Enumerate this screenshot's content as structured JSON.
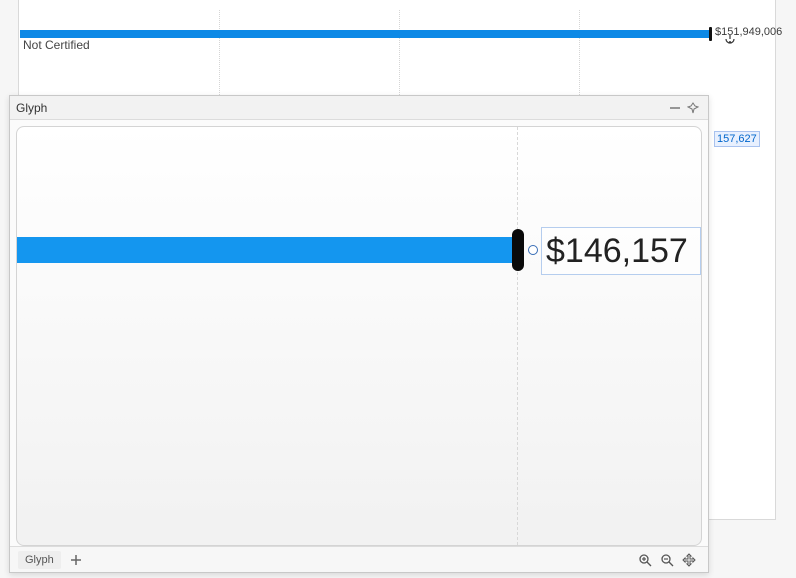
{
  "chart_data": {
    "type": "bar",
    "orientation": "horizontal",
    "categories": [
      "Not Certified"
    ],
    "values": [
      151949006
    ],
    "value_labels": [
      "$151,949,006"
    ],
    "title": "",
    "xlabel": "",
    "ylabel": ""
  },
  "background": {
    "bar_label": "Not Certified",
    "bar_value_text": "$151,949,006",
    "peek_value": "157,627"
  },
  "glyph": {
    "title": "Glyph",
    "big_value": "$146,157",
    "footer_tab": "Glyph"
  }
}
